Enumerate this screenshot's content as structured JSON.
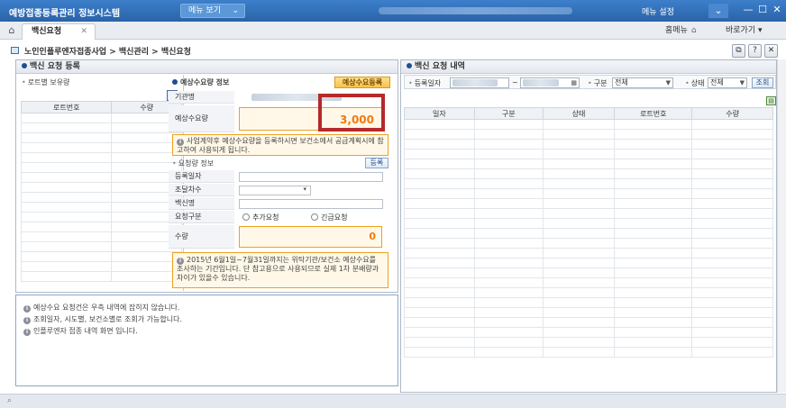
{
  "app": {
    "title": "예방접종등록관리 정보시스템",
    "menu_view_label": "메뉴 보기",
    "menu_settings_label": "메뉴 설정",
    "window_controls": [
      "⌄",
      "—",
      "☐",
      "✕"
    ]
  },
  "tabs": {
    "active_tab": "백신요청",
    "close_glyph": "✕",
    "home_menu_label": "홈메뉴",
    "shortcut_label": "바로가기"
  },
  "breadcrumb": "노인인플루엔자접종사업 > 백신관리 > 백신요청",
  "toolbar": {
    "glyphs": [
      "⧉",
      "?",
      "✕"
    ]
  },
  "left_panel": {
    "title": "백신 요청 등록",
    "lot_section_title": "로트별 보유량",
    "columns": [
      "로트번호",
      "수량"
    ]
  },
  "demand_panel": {
    "title": "예상수요량 정보",
    "register_button": "예상수요등록",
    "agency_label": "기관명",
    "demand_label": "예상수요량",
    "demand_value": "3,000",
    "info_text": "사업계약후 예상수요량을 등록하시면 보건소에서 공급계획시에 참고하여 사용되게 됩니다.",
    "request_section_title": "요청량 정보",
    "request_register_button": "등록",
    "fields": [
      "등록일자",
      "조달차수",
      "백신명",
      "요청구분",
      "수량"
    ],
    "radio_add": "추가요청",
    "radio_urgent": "긴급요청",
    "quantity_value": "0",
    "period_notice": "2015년 6월1일~7월31일까지는 위탁기관/보건소 예상수요를 조사하는 기간입니다. 단 참고용으로 사용되므로 실제 1차 분배량과 차이가 있을수 있습니다."
  },
  "right_panel": {
    "title": "백신 요청 내역",
    "filter": {
      "reg_date_label": "등록일자",
      "range_sep": "~",
      "type_label": "구분",
      "type_value": "전체",
      "status_label": "상태",
      "status_value": "전체",
      "search_button": "조회"
    },
    "columns": [
      "일자",
      "구분",
      "상태",
      "로트번호",
      "수량"
    ]
  },
  "notice": [
    "예상수요 요청건은 우측 내역에 잡히지 않습니다.",
    "조회일자, 시도별, 보건소별로 조회가 가능합니다.",
    "인플루엔자 접종 내역 화면 입니다."
  ],
  "colors": {
    "title_bar": "#2f6db5",
    "highlight_frame": "#b52a2a",
    "demand_value": "#f07a10",
    "orange_border": "#f0a020"
  }
}
